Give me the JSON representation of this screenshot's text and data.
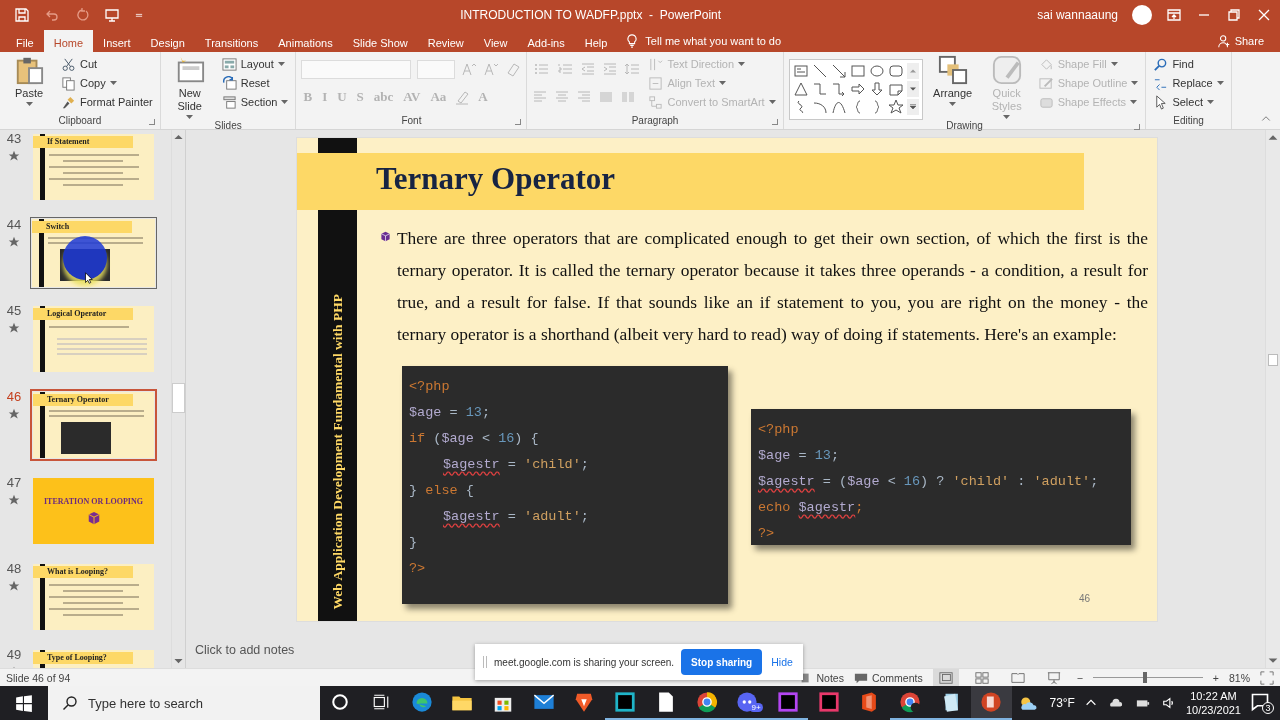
{
  "window": {
    "title": "INTRODUCTION TO WADFP.pptx  -  PowerPoint",
    "user": "sai wannaaung"
  },
  "ribbon_tabs": [
    {
      "label": "File",
      "selected": false
    },
    {
      "label": "Home",
      "selected": true
    },
    {
      "label": "Insert",
      "selected": false
    },
    {
      "label": "Design",
      "selected": false
    },
    {
      "label": "Transitions",
      "selected": false
    },
    {
      "label": "Animations",
      "selected": false
    },
    {
      "label": "Slide Show",
      "selected": false
    },
    {
      "label": "Review",
      "selected": false
    },
    {
      "label": "View",
      "selected": false
    },
    {
      "label": "Add-ins",
      "selected": false
    },
    {
      "label": "Help",
      "selected": false
    }
  ],
  "tell_me": "Tell me what you want to do",
  "share": "Share",
  "ribbon_groups": [
    {
      "label": "Clipboard",
      "launcher": true,
      "columns": [
        {
          "kind": "large",
          "label": "Paste",
          "menu": true,
          "disabled": false
        },
        {
          "kind": "stack",
          "items": [
            {
              "label": "Cut",
              "menu": false,
              "disabled": false
            },
            {
              "label": "Copy",
              "menu": true,
              "disabled": false
            },
            {
              "label": "Format Painter",
              "menu": false,
              "disabled": false
            }
          ]
        }
      ]
    },
    {
      "label": "Slides",
      "launcher": false,
      "columns": [
        {
          "kind": "large",
          "label": "New Slide",
          "menu": true,
          "disabled": false
        },
        {
          "kind": "stack",
          "items": [
            {
              "label": "Layout",
              "menu": true,
              "disabled": false
            },
            {
              "label": "Reset",
              "menu": false,
              "disabled": false
            },
            {
              "label": "Section",
              "menu": true,
              "disabled": false
            }
          ]
        }
      ]
    },
    {
      "label": "Font",
      "launcher": true,
      "columns": [
        {
          "kind": "rows",
          "rows": [
            [
              {
                "kind": "font_field",
                "disabled": true
              },
              {
                "kind": "size_field",
                "disabled": true
              },
              {
                "kind": "grow",
                "disabled": true
              },
              {
                "kind": "shrink",
                "disabled": true
              },
              {
                "kind": "clear_format",
                "disabled": true
              }
            ],
            [
              {
                "kind": "glyph",
                "label": "B",
                "disabled": true
              },
              {
                "kind": "glyph",
                "label": "I",
                "disabled": true
              },
              {
                "kind": "glyph",
                "label": "U",
                "disabled": true
              },
              {
                "kind": "glyph",
                "label": "S",
                "disabled": true
              },
              {
                "kind": "glyph",
                "label": "abc",
                "disabled": true
              },
              {
                "kind": "glyph",
                "label": "AV",
                "disabled": true
              },
              {
                "kind": "glyph",
                "label": "Aa",
                "disabled": true
              },
              {
                "kind": "highlight",
                "disabled": true
              },
              {
                "kind": "glyph",
                "label": "A",
                "disabled": true
              }
            ]
          ]
        }
      ]
    },
    {
      "label": "Paragraph",
      "launcher": true,
      "columns": [
        {
          "kind": "rows",
          "rows": [
            [
              {
                "kind": "bullets",
                "disabled": true
              },
              {
                "kind": "numbering",
                "disabled": true
              },
              {
                "kind": "outdent",
                "disabled": true
              },
              {
                "kind": "indent",
                "disabled": true
              },
              {
                "kind": "line_spacing",
                "disabled": true
              }
            ],
            [
              {
                "kind": "align_left",
                "disabled": true
              },
              {
                "kind": "align_center",
                "disabled": true
              },
              {
                "kind": "align_right",
                "disabled": true
              },
              {
                "kind": "justify",
                "disabled": true
              },
              {
                "kind": "text_columns",
                "disabled": true
              }
            ]
          ]
        },
        {
          "kind": "stack",
          "items": [
            {
              "label": "Text Direction",
              "menu": true,
              "disabled": true
            },
            {
              "label": "Align Text",
              "menu": true,
              "disabled": true
            },
            {
              "label": "Convert to SmartArt",
              "menu": true,
              "disabled": true
            }
          ]
        }
      ]
    },
    {
      "label": "Drawing",
      "launcher": true,
      "columns": [
        {
          "kind": "gallery"
        },
        {
          "kind": "large",
          "label": "Arrange",
          "menu": true,
          "disabled": false
        },
        {
          "kind": "large",
          "label": "Quick Styles",
          "menu": true,
          "disabled": true
        },
        {
          "kind": "stack",
          "items": [
            {
              "label": "Shape Fill",
              "menu": true,
              "disabled": true
            },
            {
              "label": "Shape Outline",
              "menu": true,
              "disabled": true
            },
            {
              "label": "Shape Effects",
              "menu": true,
              "disabled": true
            }
          ]
        }
      ]
    },
    {
      "label": "Editing",
      "launcher": false,
      "columns": [
        {
          "kind": "stack",
          "items": [
            {
              "label": "Find",
              "menu": false,
              "disabled": false
            },
            {
              "label": "Replace",
              "menu": true,
              "disabled": false
            },
            {
              "label": "Select",
              "menu": true,
              "disabled": false
            }
          ]
        }
      ]
    }
  ],
  "thumbnails": [
    {
      "number": "43",
      "title": "If Statement",
      "kind": "content",
      "selected": false,
      "hovered": false
    },
    {
      "number": "44",
      "title": "Switch",
      "kind": "code",
      "selected": false,
      "hovered": true
    },
    {
      "number": "45",
      "title": "Logical Operator",
      "kind": "table",
      "selected": false,
      "hovered": false
    },
    {
      "number": "46",
      "title": "Ternary Operator",
      "kind": "code",
      "selected": true,
      "hovered": false
    },
    {
      "number": "47",
      "title": "ITERATION OR LOOPING",
      "kind": "section",
      "selected": false,
      "hovered": false
    },
    {
      "number": "48",
      "title": "What is Looping?",
      "kind": "content",
      "selected": false,
      "hovered": false
    },
    {
      "number": "49",
      "title": "Type of Looping?",
      "kind": "content",
      "selected": false,
      "hovered": false
    }
  ],
  "slide": {
    "side_title": "Web Application Development Fundamental with PHP",
    "title": "Ternary Operator",
    "paragraph": "There are three operators that are complicated enough to get their own section, of which the first is the ternary operator. It is called the ternary operator because it takes three operands - a condition, a result for true, and a result for false. If that sounds like an if statement to you, you are right on the money - the ternary operator is a shorthand (albeit very hard to read) way of doing if statements. Here's an example:",
    "code_blocks": [
      {
        "lines": [
          {
            "indent": false,
            "tokens": [
              {
                "text": "<?php",
                "kind": "tag"
              }
            ]
          },
          {
            "indent": false,
            "tokens": [
              {
                "text": "$age",
                "kind": "var"
              },
              {
                "text": " = ",
                "kind": "plain"
              },
              {
                "text": "13",
                "kind": "number"
              },
              {
                "text": ";",
                "kind": "plain"
              }
            ]
          },
          {
            "indent": false,
            "tokens": [
              {
                "text": "if",
                "kind": "keyword"
              },
              {
                "text": " (",
                "kind": "plain"
              },
              {
                "text": "$age",
                "kind": "var"
              },
              {
                "text": " < ",
                "kind": "plain"
              },
              {
                "text": "16",
                "kind": "number"
              },
              {
                "text": ") {",
                "kind": "plain"
              }
            ]
          },
          {
            "indent": true,
            "tokens": [
              {
                "text": "$agestr",
                "kind": "var",
                "misspelled": true
              },
              {
                "text": " = ",
                "kind": "plain"
              },
              {
                "text": "'child'",
                "kind": "string"
              },
              {
                "text": ";",
                "kind": "plain"
              }
            ]
          },
          {
            "indent": false,
            "tokens": [
              {
                "text": "} ",
                "kind": "plain"
              },
              {
                "text": "else",
                "kind": "keyword"
              },
              {
                "text": " {",
                "kind": "plain"
              }
            ]
          },
          {
            "indent": true,
            "tokens": [
              {
                "text": "$agestr",
                "kind": "var",
                "misspelled": true
              },
              {
                "text": " = ",
                "kind": "plain"
              },
              {
                "text": "'adult'",
                "kind": "string"
              },
              {
                "text": ";",
                "kind": "plain"
              }
            ]
          },
          {
            "indent": false,
            "tokens": [
              {
                "text": "}",
                "kind": "plain"
              }
            ]
          },
          {
            "indent": false,
            "tokens": [
              {
                "text": "?>",
                "kind": "tag"
              }
            ]
          }
        ]
      },
      {
        "lines": [
          {
            "indent": false,
            "tokens": [
              {
                "text": "<?php",
                "kind": "tag"
              }
            ]
          },
          {
            "indent": false,
            "tokens": [
              {
                "text": "$age",
                "kind": "var"
              },
              {
                "text": " = ",
                "kind": "plain"
              },
              {
                "text": "13",
                "kind": "number"
              },
              {
                "text": ";",
                "kind": "plain"
              }
            ]
          },
          {
            "indent": false,
            "tokens": [
              {
                "text": "$agestr",
                "kind": "var",
                "misspelled": true
              },
              {
                "text": " = (",
                "kind": "plain"
              },
              {
                "text": "$age",
                "kind": "var"
              },
              {
                "text": " < ",
                "kind": "plain"
              },
              {
                "text": "16",
                "kind": "number"
              },
              {
                "text": ") ? ",
                "kind": "plain"
              },
              {
                "text": "'child'",
                "kind": "string"
              },
              {
                "text": " : ",
                "kind": "plain"
              },
              {
                "text": "'adult'",
                "kind": "string"
              },
              {
                "text": ";",
                "kind": "plain"
              }
            ]
          },
          {
            "indent": false,
            "tokens": [
              {
                "text": "echo ",
                "kind": "keyword"
              },
              {
                "text": "$agestr",
                "kind": "var",
                "misspelled": true
              },
              {
                "text": ";",
                "kind": "keyword"
              }
            ]
          },
          {
            "indent": false,
            "tokens": [
              {
                "text": "?>",
                "kind": "tag"
              }
            ]
          }
        ]
      }
    ],
    "number": "46"
  },
  "notes_placeholder": "Click to add notes",
  "sharing": {
    "message": "meet.google.com is sharing your screen.",
    "stop": "Stop sharing",
    "hide": "Hide"
  },
  "status_bar": {
    "slide": "Slide 46 of 94",
    "notes": "Notes",
    "comments": "Comments",
    "zoom_out": "−",
    "zoom_in": "+",
    "zoom": "81%",
    "level": 0.46
  },
  "taskbar": {
    "search_placeholder": "Type here to search",
    "apps": [
      {
        "running": false,
        "selected": false
      },
      {
        "running": false,
        "selected": false
      },
      {
        "running": false,
        "selected": false
      },
      {
        "running": false,
        "selected": false
      },
      {
        "running": false,
        "selected": false
      },
      {
        "running": true,
        "selected": false
      },
      {
        "running": true,
        "selected": false
      },
      {
        "running": true,
        "selected": false
      },
      {
        "running": true,
        "selected": false,
        "badge": "9+"
      },
      {
        "running": true,
        "selected": false
      },
      {
        "running": false,
        "selected": false
      },
      {
        "running": false,
        "selected": false
      },
      {
        "running": true,
        "selected": false
      },
      {
        "running": true,
        "selected": false
      },
      {
        "running": true,
        "selected": true
      }
    ],
    "temperature": "73°F",
    "time": "10:22 AM",
    "date": "10/23/2021",
    "notifications": "3"
  }
}
